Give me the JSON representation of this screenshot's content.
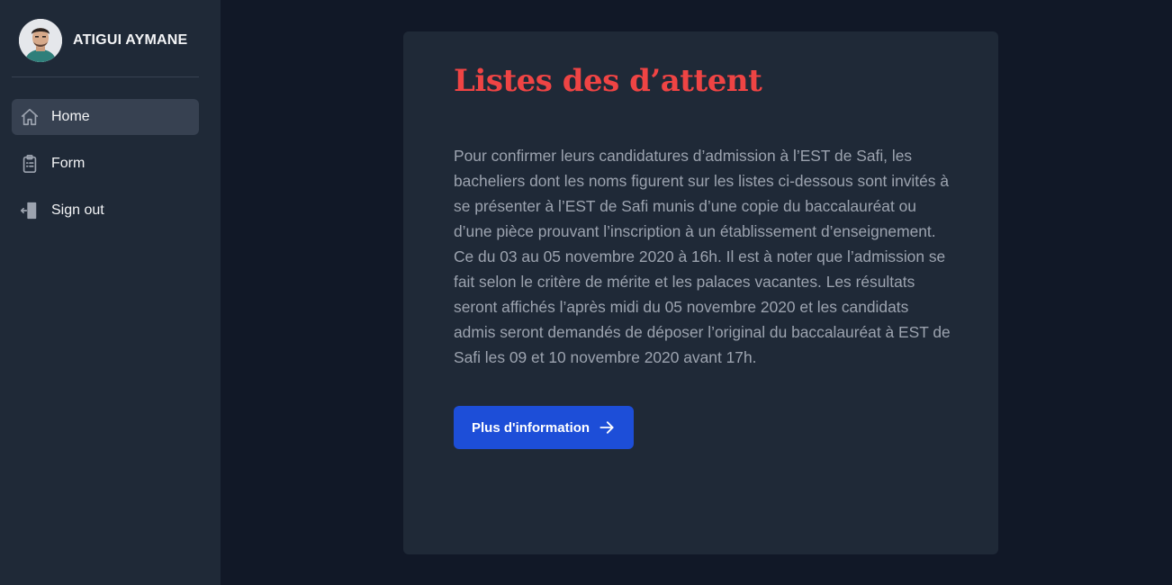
{
  "profile": {
    "name": "ATIGUI AYMANE"
  },
  "sidebar": {
    "items": [
      {
        "label": "Home",
        "icon": "home-icon",
        "active": true
      },
      {
        "label": "Form",
        "icon": "clipboard-list-icon",
        "active": false
      },
      {
        "label": "Sign out",
        "icon": "door-exit-icon",
        "active": false
      }
    ]
  },
  "main": {
    "title": "Listes des d’attent",
    "body": "Pour confirmer leurs candidatures d’admission à l’EST de Safi, les bacheliers dont les noms figurent sur les listes ci-dessous sont invités à se présenter à l’EST de Safi munis d’une copie du baccalauréat ou d’une pièce prouvant l’inscription à un établissement d’enseignement. Ce du 03 au 05 novembre 2020 à 16h. Il est à noter que l’admission se fait selon le critère de mérite et les palaces vacantes. Les résultats seront affichés l’après midi du 05 novembre 2020 et les candidats admis seront demandés de déposer l’original du baccalauréat à EST de Safi les 09 et 10 novembre 2020 avant 17h.",
    "cta_label": "Plus d'information",
    "cta_icon": "arrow-right-icon"
  },
  "colors": {
    "background": "#111827",
    "sidebar": "#1f2937",
    "card": "#1f2937",
    "active_item": "#374151",
    "title": "#ef4444",
    "body_text": "#9ca3af",
    "button": "#1d4ed8"
  }
}
